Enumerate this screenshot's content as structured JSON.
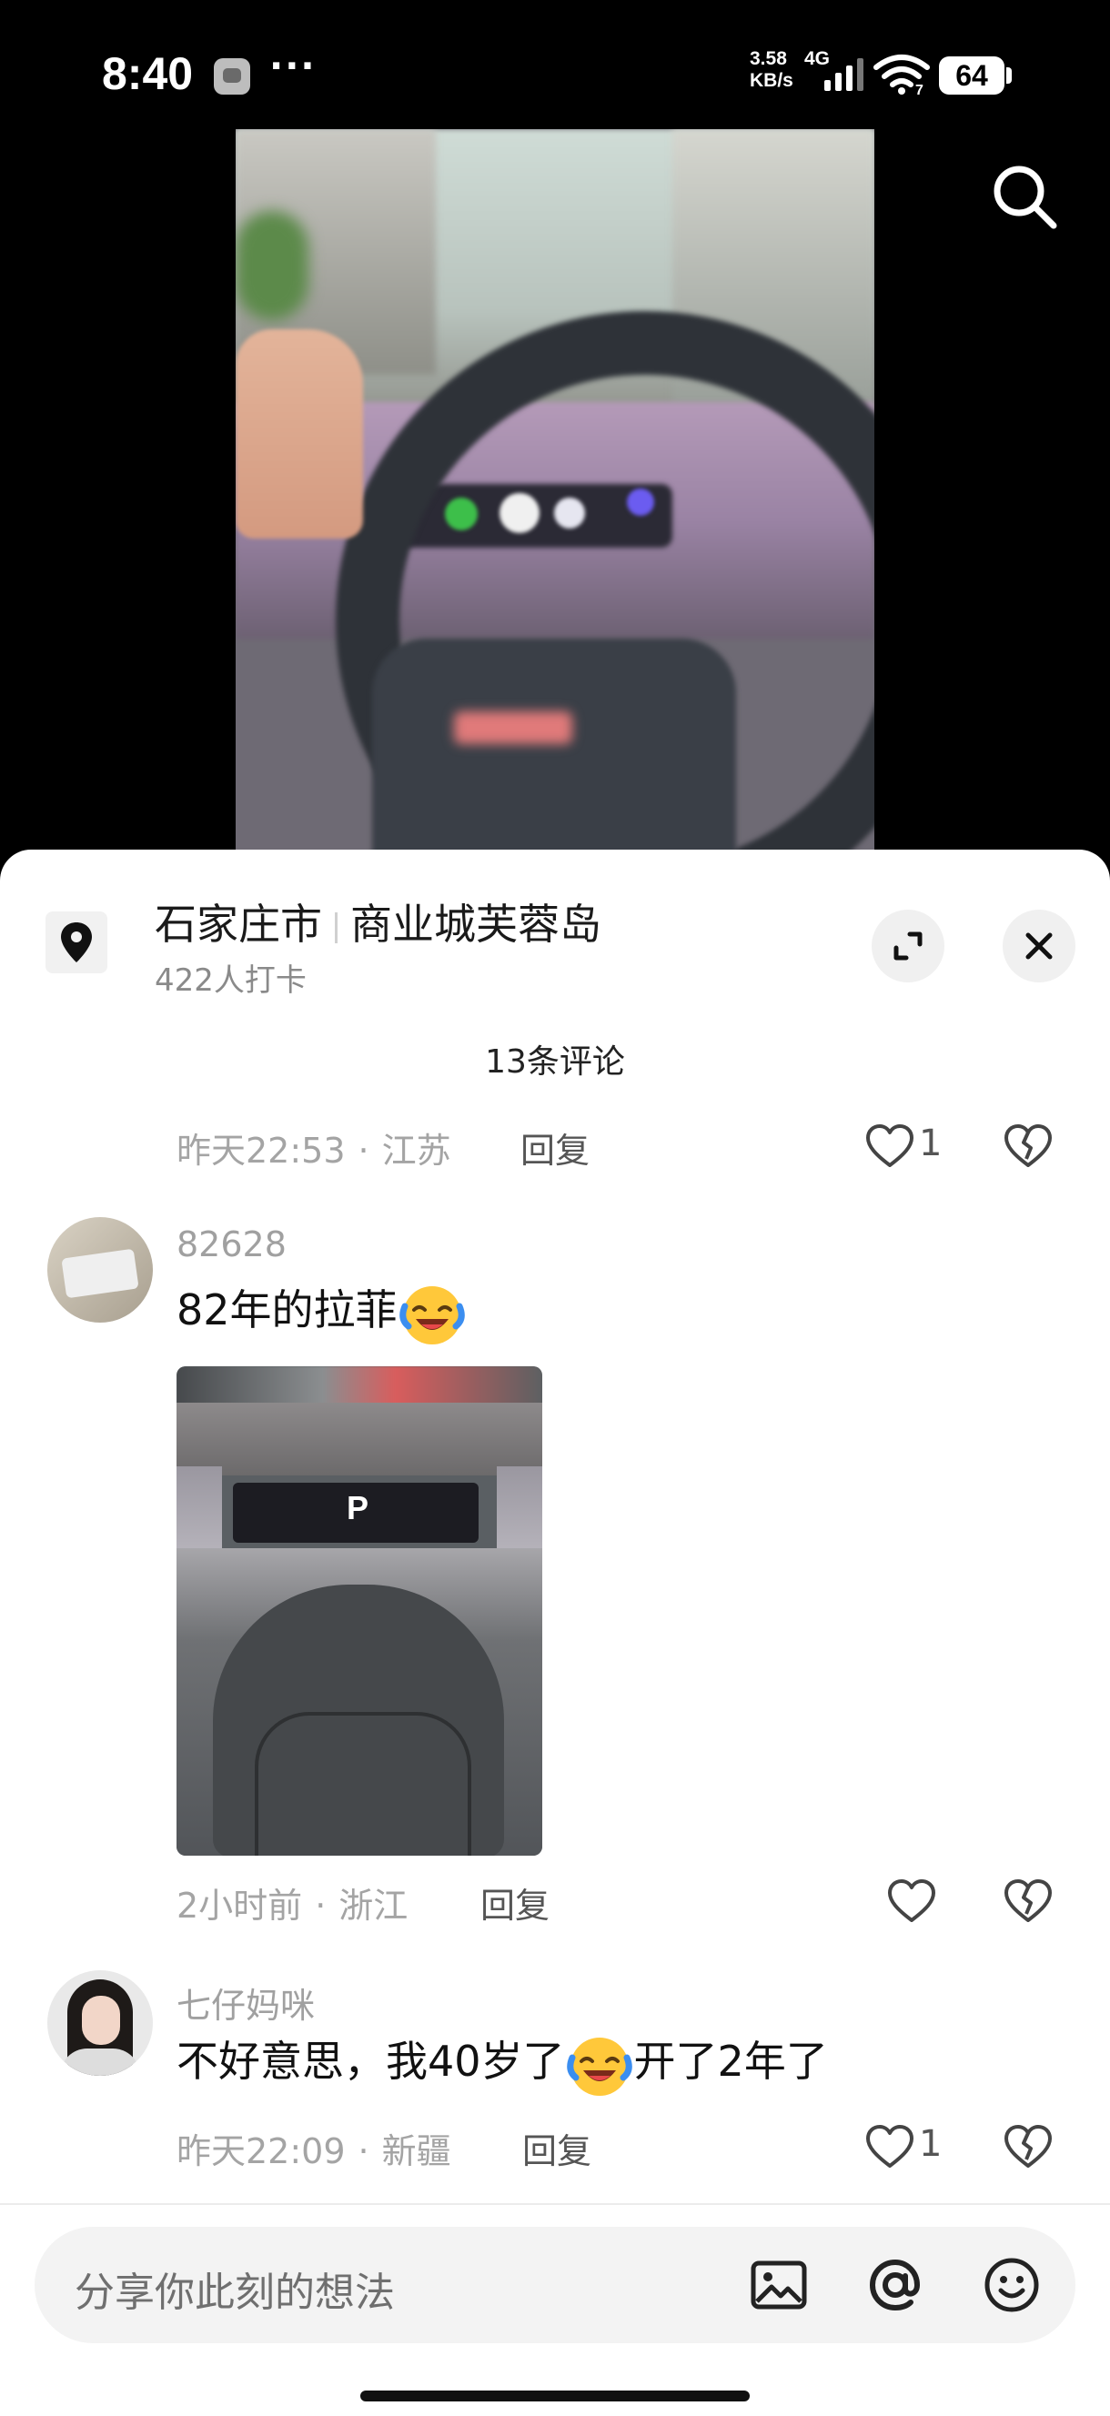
{
  "status_bar": {
    "time": "8:40",
    "net_speed_value": "3.58",
    "net_speed_unit": "KB/s",
    "network_type": "4G",
    "wifi_label": "7",
    "battery": "64"
  },
  "video": {
    "icon": "search-icon"
  },
  "location": {
    "city": "石家庄市",
    "name": "商业城芙蓉岛",
    "checkins": "422人打卡"
  },
  "comments_header": "13条评论",
  "partial_comment": {
    "time": "昨天22:53",
    "region": "江苏",
    "reply": "回复",
    "likes": "1"
  },
  "comments": [
    {
      "username": "82628",
      "text": "82年的拉菲",
      "emoji": "crying-laughing-emoji",
      "image_text": "P",
      "time": "2小时前",
      "region": "浙江",
      "reply": "回复",
      "likes": ""
    },
    {
      "username": "七仔妈咪",
      "text_before": "不好意思，我40岁了",
      "emoji": "crying-laughing-emoji",
      "text_after": "开了2年了",
      "time": "昨天22:09",
      "region": "新疆",
      "reply": "回复",
      "likes": "1"
    }
  ],
  "input": {
    "placeholder": "分享你此刻的想法",
    "icons": [
      "image-icon",
      "at-icon",
      "emoji-icon"
    ]
  },
  "colors": {
    "sheet_bg": "#ffffff",
    "meta_gray": "#a4a4a4",
    "emoji_yellow": "#ffc83a",
    "emoji_blue": "#3b8ef0"
  }
}
